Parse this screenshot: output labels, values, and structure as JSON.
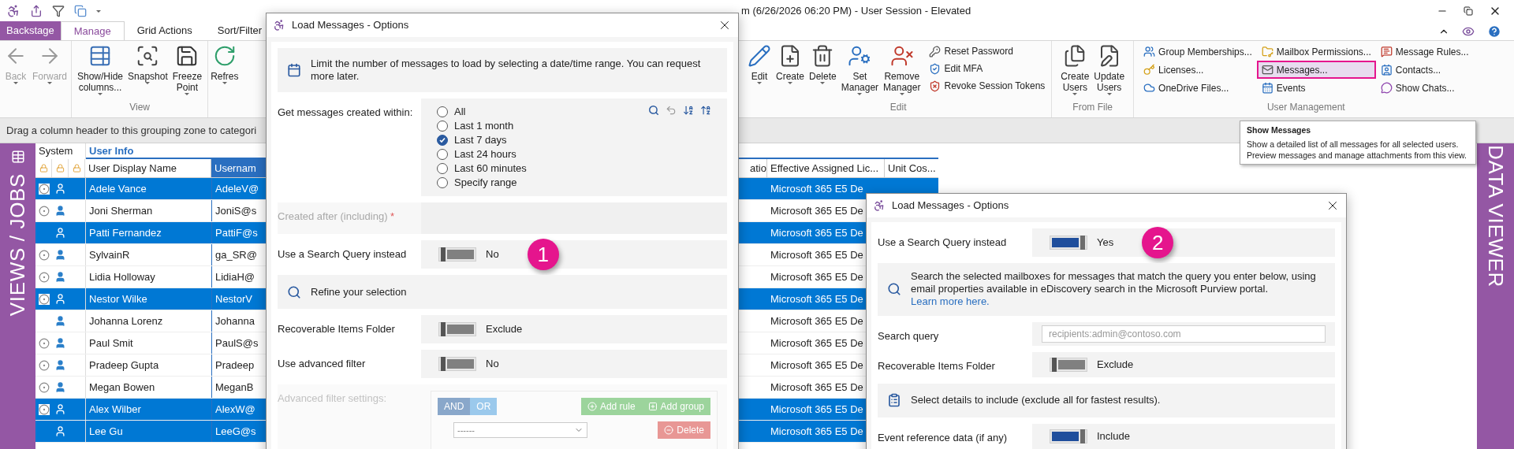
{
  "title_bar": {
    "title": "m (6/26/2026 06:20 PM) - User Session - Elevated"
  },
  "ribbon_tabs": [
    {
      "label": "Backstage",
      "kind": "backstage",
      "selected": false
    },
    {
      "label": "Manage",
      "kind": "tab",
      "selected": true
    },
    {
      "label": "Grid Actions",
      "kind": "tab",
      "selected": false
    },
    {
      "label": "Sort/Filter",
      "kind": "tab",
      "selected": false
    }
  ],
  "ribbon_left": {
    "nav_buttons": [
      {
        "label": "Back",
        "disabled": true
      },
      {
        "label": "Forward",
        "disabled": true
      }
    ],
    "view_group": {
      "label": "View",
      "buttons": [
        {
          "label": "Show/Hide\ncolumns..."
        },
        {
          "label": "Snapshot"
        },
        {
          "label": "Freeze\nPoint"
        }
      ]
    },
    "refresh_button": {
      "label": "Refres"
    }
  },
  "ribbon_right": {
    "edit_group": {
      "label": "Edit",
      "large_buttons": [
        {
          "label": "Edit"
        },
        {
          "label": "Create"
        },
        {
          "label": "Delete"
        },
        {
          "label": "Set\nManager"
        },
        {
          "label": "Remove\nManager"
        }
      ],
      "small_buttons": [
        {
          "label": "Reset Password"
        },
        {
          "label": "Edit MFA"
        },
        {
          "label": "Revoke Session Tokens"
        }
      ]
    },
    "file_group": {
      "label": "From File",
      "buttons": [
        {
          "label": "Create\nUsers"
        },
        {
          "label": "Update\nUsers"
        }
      ]
    },
    "user_group": {
      "label": "User Management",
      "columns": [
        [
          {
            "label": "Group Memberships...",
            "highlighted": false
          },
          {
            "label": "Licenses...",
            "highlighted": false
          },
          {
            "label": "OneDrive Files...",
            "highlighted": false
          }
        ],
        [
          {
            "label": "Mailbox Permissions...",
            "highlighted": false
          },
          {
            "label": "Messages...",
            "highlighted": true
          },
          {
            "label": "Events",
            "highlighted": false
          }
        ],
        [
          {
            "label": "Message Rules...",
            "highlighted": false
          },
          {
            "label": "Contacts...",
            "highlighted": false
          },
          {
            "label": "Show Chats...",
            "highlighted": false
          }
        ]
      ]
    }
  },
  "grouping_zone": "Drag a column header to this grouping zone to categori",
  "left_panel": "VIEWS / JOBS",
  "right_panel": "DATA VIEWER",
  "grid": {
    "bands": [
      "System",
      "User Info"
    ],
    "columns": [
      "User Display Name",
      "Usernam",
      "atio",
      "Effective Assigned Lic...",
      "Unit Cos..."
    ],
    "rows": [
      {
        "marked": true,
        "selected": true,
        "display_name": "Adele Vance",
        "username": "AdeleV@",
        "license": "Microsoft 365 E5 De"
      },
      {
        "marked": true,
        "selected": false,
        "display_name": "Joni Sherman",
        "username": "JoniS@s",
        "license": "Microsoft 365 E5 De"
      },
      {
        "marked": false,
        "selected": true,
        "display_name": "Patti Fernandez",
        "username": "PattiF@s",
        "license": "Microsoft 365 E5 De"
      },
      {
        "marked": true,
        "selected": false,
        "display_name": "SylvainR",
        "username": "ga_SR@",
        "license": "Microsoft 365 E5 De"
      },
      {
        "marked": true,
        "selected": false,
        "display_name": "Lidia Holloway",
        "username": "LidiaH@",
        "license": "Microsoft 365 E5 De"
      },
      {
        "marked": true,
        "selected": true,
        "display_name": "Nestor Wilke",
        "username": "NestorV",
        "license": "Microsoft 365 E5 De"
      },
      {
        "marked": false,
        "selected": false,
        "display_name": "Johanna Lorenz",
        "username": "Johanna",
        "license": "Microsoft 365 E5 De"
      },
      {
        "marked": true,
        "selected": false,
        "display_name": "Paul Smit",
        "username": "PaulS@s",
        "license": "Microsoft 365 E5 De"
      },
      {
        "marked": true,
        "selected": false,
        "display_name": "Pradeep Gupta",
        "username": "Pradeep",
        "license": "Microsoft 365 E5 De"
      },
      {
        "marked": true,
        "selected": false,
        "display_name": "Megan Bowen",
        "username": "MeganB",
        "license": "Microsoft 365 E5 De"
      },
      {
        "marked": true,
        "selected": true,
        "display_name": "Alex Wilber",
        "username": "AlexW@",
        "license": "Microsoft 365 E5 De"
      },
      {
        "marked": false,
        "selected": true,
        "display_name": "Lee Gu",
        "username": "LeeG@s",
        "license": "Microsoft 365 E5 De"
      }
    ]
  },
  "tooltip": {
    "title": "Show Messages",
    "lines": [
      "Show a detailed list of all messages for all selected users.",
      "Preview messages and manage attachments from this view."
    ]
  },
  "dialogs": [
    {
      "title": "Load Messages - Options",
      "rows": [
        {
          "kind": "info",
          "text": "Limit the number of messages to load by selecting a date/time range. You can request more later."
        },
        {
          "kind": "radio",
          "label": "Get messages created within:",
          "options": [
            {
              "label": "All",
              "selected": false
            },
            {
              "label": "Last 1 month",
              "selected": false
            },
            {
              "label": "Last 7 days",
              "selected": true
            },
            {
              "label": "Last 24 hours",
              "selected": false
            },
            {
              "label": "Last 60 minutes",
              "selected": false
            },
            {
              "label": "Specify range",
              "selected": false
            }
          ]
        },
        {
          "kind": "field",
          "label": "Created after (including)",
          "required": "*",
          "disabled": true
        },
        {
          "kind": "toggle",
          "label": "Use a Search Query instead",
          "on": false,
          "value": "No",
          "badge": "1"
        },
        {
          "kind": "info",
          "text": "Refine your selection"
        },
        {
          "kind": "toggle",
          "label": "Recoverable Items Folder",
          "on": false,
          "value": "Exclude"
        },
        {
          "kind": "toggle",
          "label": "Use advanced filter",
          "on": false,
          "value": "No"
        },
        {
          "kind": "filter",
          "label": "Advanced filter settings:",
          "disabled": true,
          "operators": [
            {
              "label": "AND",
              "selected": true
            },
            {
              "label": "OR",
              "selected": false
            }
          ],
          "add_rule": "Add rule",
          "add_group": "Add group",
          "rule_select": "------",
          "delete": "Delete"
        }
      ]
    },
    {
      "title": "Load Messages - Options",
      "rows": [
        {
          "kind": "toggle",
          "label": "Use a Search Query instead",
          "on": true,
          "value": "Yes",
          "badge": "2"
        },
        {
          "kind": "info",
          "text": "Search the selected mailboxes for messages that match the query you enter below, using email properties available in eDiscovery search in the Microsoft Purview portal.",
          "link": "Learn more here."
        },
        {
          "kind": "input",
          "label": "Search query",
          "placeholder": "recipients:admin@contoso.com"
        },
        {
          "kind": "toggle",
          "label": "Recoverable Items Folder",
          "on": false,
          "value": "Exclude"
        },
        {
          "kind": "info",
          "text": "Select details to include (exclude all for fastest results)."
        },
        {
          "kind": "toggle",
          "label": "Event reference data (if any)",
          "on": true,
          "value": "Include"
        }
      ]
    }
  ]
}
